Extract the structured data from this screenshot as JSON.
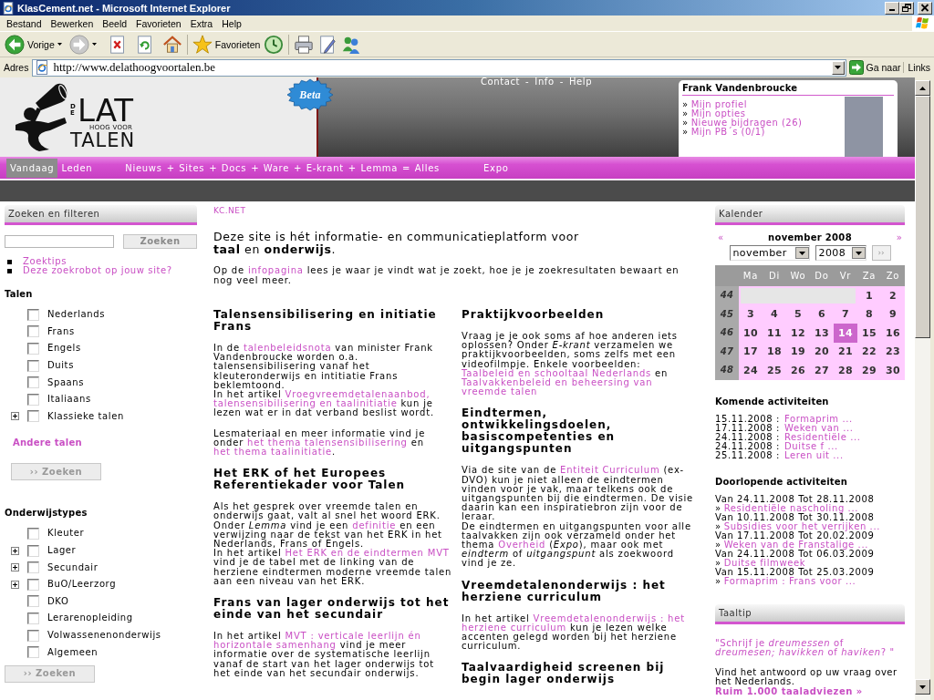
{
  "window": {
    "title": "KlasCement.net - Microsoft Internet Explorer"
  },
  "menu": [
    "Bestand",
    "Bewerken",
    "Beeld",
    "Favorieten",
    "Extra",
    "Help"
  ],
  "toolbar": {
    "back": "Vorige",
    "favorites": "Favorieten"
  },
  "address_bar": {
    "label": "Adres",
    "url": "http://www.delathoogvoortalen.be",
    "go": "Ga naar",
    "links": "Links"
  },
  "header": {
    "logo": {
      "prefix": "DE",
      "word": "LAT",
      "line2": "HOOG VOOR",
      "line3": "TALEN"
    },
    "badge": "Beta",
    "top_links": {
      "items": [
        "Contact",
        "Info",
        "Help"
      ],
      "separator": "-"
    },
    "profile": {
      "name": "Frank Vandenbroucke",
      "bullet": "»",
      "links": [
        "Mijn profiel",
        "Mijn opties",
        "Nieuwe bijdragen (26)",
        "Mijn PB´s (0/1)"
      ]
    }
  },
  "nav": [
    {
      "kind": "tab",
      "label": "Vandaag",
      "selected": true
    },
    {
      "kind": "tab",
      "label": "Leden",
      "selected": false
    },
    {
      "kind": "group",
      "items": [
        {
          "label": "Nieuws",
          "selected": false
        },
        {
          "label": "Sites",
          "selected": false
        },
        {
          "label": "Docs",
          "selected": false
        },
        {
          "label": "Ware",
          "selected": false
        },
        {
          "label": "E-krant",
          "selected": false
        },
        {
          "label": "Lemma",
          "selected": false
        }
      ],
      "joiner": "+",
      "equals": "=",
      "total": {
        "label": "Alles",
        "selected": false
      }
    },
    {
      "kind": "tab",
      "label": "Expo",
      "selected": false
    }
  ],
  "search": {
    "title": "Zoeken en filteren",
    "button": "Zoeken",
    "links": [
      "Zoektips",
      "Deze zoekrobot op jouw site?"
    ]
  },
  "filters": [
    {
      "title": "Talen",
      "items": [
        {
          "label": "Nederlands",
          "checked": false,
          "expandable": false
        },
        {
          "label": "Frans",
          "checked": false,
          "expandable": false
        },
        {
          "label": "Engels",
          "checked": false,
          "expandable": false
        },
        {
          "label": "Duits",
          "checked": false,
          "expandable": false
        },
        {
          "label": "Spaans",
          "checked": false,
          "expandable": false
        },
        {
          "label": "Italiaans",
          "checked": false,
          "expandable": false
        },
        {
          "label": "Klassieke talen",
          "checked": false,
          "expandable": true
        }
      ],
      "more": "Andere talen",
      "button": "›› Zoeken"
    },
    {
      "title": "Onderwijstypes",
      "items": [
        {
          "label": "Kleuter",
          "checked": false,
          "expandable": false
        },
        {
          "label": "Lager",
          "checked": false,
          "expandable": true
        },
        {
          "label": "Secundair",
          "checked": false,
          "expandable": true
        },
        {
          "label": "BuO/Leerzorg",
          "checked": false,
          "expandable": true
        },
        {
          "label": "DKO",
          "checked": false,
          "expandable": false
        },
        {
          "label": "Lerarenopleiding",
          "checked": false,
          "expandable": false
        },
        {
          "label": "Volwassenenonderwijs",
          "checked": false,
          "expandable": false
        },
        {
          "label": "Algemeen",
          "checked": false,
          "expandable": false
        }
      ],
      "button": "›› Zoeken"
    }
  ],
  "content": {
    "breadcrumb": "KC.NET",
    "intro": "Deze site is hét informatie- en communicatieplatform voor **taal** en **onderwijs**.",
    "note": [
      {
        "text": "Op de "
      },
      {
        "link": "infopagina"
      },
      {
        "text": " lees je waar je vindt wat je zoekt, hoe je je zoekresultaten bewaart en nog veel meer."
      }
    ],
    "columns": [
      [
        {
          "heading": "Talensensibilisering en initiatie Frans",
          "paragraphs": [
            [
              {
                "text": "In de "
              },
              {
                "link": "talenbeleidsnota"
              },
              {
                "text": " van minister Frank Vandenbroucke worden o.a. talensensibilisering vanaf het kleuteronderwijs en intitiatie Frans beklemtoond.\nIn het artikel "
              },
              {
                "link": "Vroegvreemdetalenaanbod,"
              },
              {
                "link": "talensensibilisering en taalinitiatie"
              },
              {
                "text": " kun je lezen wat er in dat verband beslist wordt."
              }
            ],
            [
              {
                "text": "Lesmateriaal en meer informatie vind je onder "
              },
              {
                "link": "het thema talensensibilisering"
              },
              {
                "text": " en "
              },
              {
                "link": "het thema taalinitiatie"
              },
              {
                "text": "."
              }
            ]
          ]
        },
        {
          "heading": "Het ERK of het Europees Referentiekader voor Talen",
          "paragraphs": [
            [
              {
                "text": "Als het gesprek over vreemde talen en onderwijs gaat, valt al snel het woord ERK. Onder *Lemma* vind je een "
              },
              {
                "link": "definitie"
              },
              {
                "text": " en een verwijzing naar de tekst van het ERK in het Nederlands, Frans of Engels.\nIn het artikel "
              },
              {
                "link": "Het ERK en de eindtermen"
              },
              {
                "link": "MVT"
              },
              {
                "text": " vind je de tabel met de linking van de herziene eindtermen moderne vreemde talen aan een niveau van het ERK."
              }
            ]
          ]
        },
        {
          "heading": "Frans van lager onderwijs tot het einde van het secundair",
          "paragraphs": [
            [
              {
                "text": "In het artikel "
              },
              {
                "link": "MVT : verticale leerlijn én"
              },
              {
                "link": "horizontale samenhang"
              },
              {
                "text": " vind je meer informatie over de systematische leerlijn vanaf de start van het lager onderwijs tot het einde van het secundair onderwijs."
              }
            ]
          ]
        }
      ],
      [
        {
          "heading": "Praktijkvoorbeelden",
          "paragraphs": [
            [
              {
                "text": "Vraag je je ook soms af hoe anderen iets oplossen? Onder *E-krant* verzamelen we praktijkvoorbeelden, soms zelfs met een videofilmpje. Enkele voorbeelden: "
              },
              {
                "link": "Taalbeleid en schooltaal Nederlands"
              },
              {
                "text": " en "
              },
              {
                "link": "Taalvakkenbeleid en beheersing van"
              },
              {
                "link": "vreemde talen"
              }
            ]
          ]
        },
        {
          "heading": "Eindtermen, ontwikkelingsdoelen, basiscompetenties en uitgangspunten",
          "paragraphs": [
            [
              {
                "text": "Via de site van de "
              },
              {
                "link": "Entiteit Curriculum"
              },
              {
                "text": " (ex-DVO) kun je niet alleen de eindtermen vinden voor je vak, maar telkens ook de uitgangspunten bij die eindtermen. De visie daarin kan een inspiratiebron zijn voor de leraar.\nDe eindtermen en uitgangspunten voor alle taalvakken zijn ook verzameld onder het thema "
              },
              {
                "link": "Overheid"
              },
              {
                "text": " (*Expo*), maar ook met *eindterm* of *uitgangspunt* als zoekwoord vind je ze."
              }
            ]
          ]
        },
        {
          "heading": "Vreemdetalenonderwijs : het herziene curriculum",
          "paragraphs": [
            [
              {
                "text": "In het artikel "
              },
              {
                "link": "Vreemdetalenonderwijs : het"
              },
              {
                "link": "herziene curriculum"
              },
              {
                "text": " kun je lezen welke accenten gelegd worden bij het herziene curriculum."
              }
            ]
          ]
        },
        {
          "heading": "Taalvaardigheid screenen bij begin lager onderwijs"
        }
      ]
    ]
  },
  "calendar": {
    "title": "Kalender",
    "prev": "«",
    "next": "»",
    "caption": "november 2008",
    "month": "november",
    "year": "2008",
    "go": "››",
    "weekdays": [
      "Ma",
      "Di",
      "Wo",
      "Do",
      "Vr",
      "Za",
      "Zo"
    ],
    "weeks": [
      {
        "number": "44",
        "days": [
          {
            "day": "1",
            "selected": false
          },
          {
            "day": "2",
            "selected": false
          }
        ]
      },
      {
        "number": "45",
        "days": [
          {
            "day": "3",
            "selected": false
          },
          {
            "day": "4",
            "selected": false
          },
          {
            "day": "5",
            "selected": false
          },
          {
            "day": "6",
            "selected": false
          },
          {
            "day": "7",
            "selected": false
          },
          {
            "day": "8",
            "selected": false
          },
          {
            "day": "9",
            "selected": false
          }
        ]
      },
      {
        "number": "46",
        "days": [
          {
            "day": "10",
            "selected": false
          },
          {
            "day": "11",
            "selected": false
          },
          {
            "day": "12",
            "selected": false
          },
          {
            "day": "13",
            "selected": false
          },
          {
            "day": "14",
            "selected": true
          },
          {
            "day": "15",
            "selected": false
          },
          {
            "day": "16",
            "selected": false
          }
        ]
      },
      {
        "number": "47",
        "days": [
          {
            "day": "17",
            "selected": false
          },
          {
            "day": "18",
            "selected": false
          },
          {
            "day": "19",
            "selected": false
          },
          {
            "day": "20",
            "selected": false
          },
          {
            "day": "21",
            "selected": false
          },
          {
            "day": "22",
            "selected": false
          },
          {
            "day": "23",
            "selected": false
          }
        ]
      },
      {
        "number": "48",
        "days": [
          {
            "day": "24",
            "selected": false
          },
          {
            "day": "25",
            "selected": false
          },
          {
            "day": "26",
            "selected": false
          },
          {
            "day": "27",
            "selected": false
          },
          {
            "day": "28",
            "selected": false
          },
          {
            "day": "29",
            "selected": false
          },
          {
            "day": "30",
            "selected": false
          }
        ]
      }
    ]
  },
  "upcoming": {
    "title": "Komende activiteiten",
    "separator": ":",
    "items": [
      {
        "date": "15.11.2008",
        "link": "Formaprim ..."
      },
      {
        "date": "17.11.2008",
        "link": "Weken van ..."
      },
      {
        "date": "24.11.2008",
        "link": "Residentiële ..."
      },
      {
        "date": "24.11.2008",
        "link": "Duitse f ..."
      },
      {
        "date": "25.11.2008",
        "link": "Leren uit ..."
      }
    ]
  },
  "ongoing": {
    "title": "Doorlopende activiteiten",
    "bullet": "»",
    "items": [
      {
        "period": "Van 24.11.2008 Tot 28.11.2008",
        "link": "Residentiële nascholing ..."
      },
      {
        "period": "Van 10.11.2008 Tot 30.11.2008",
        "link": "Subsidies voor het verrijken ..."
      },
      {
        "period": "Van 17.11.2008 Tot 20.02.2009",
        "link": "Weken van de Franstalige ..."
      },
      {
        "period": "Van 24.11.2008 Tot 06.03.2009",
        "link": "Duitse filmweek"
      },
      {
        "period": "Van 15.11.2008 Tot 25.03.2009",
        "link": "Formaprim : Frans voor ..."
      }
    ]
  },
  "tip": {
    "title": "Taaltip",
    "question": "\"Schrijf je *dreumessen* of *dreumesen; havikken* of *haviken*? \"",
    "text": "Vind het antwoord op uw vraag over het Nederlands.",
    "link": "Ruim 1.000 taaladviezen »"
  }
}
